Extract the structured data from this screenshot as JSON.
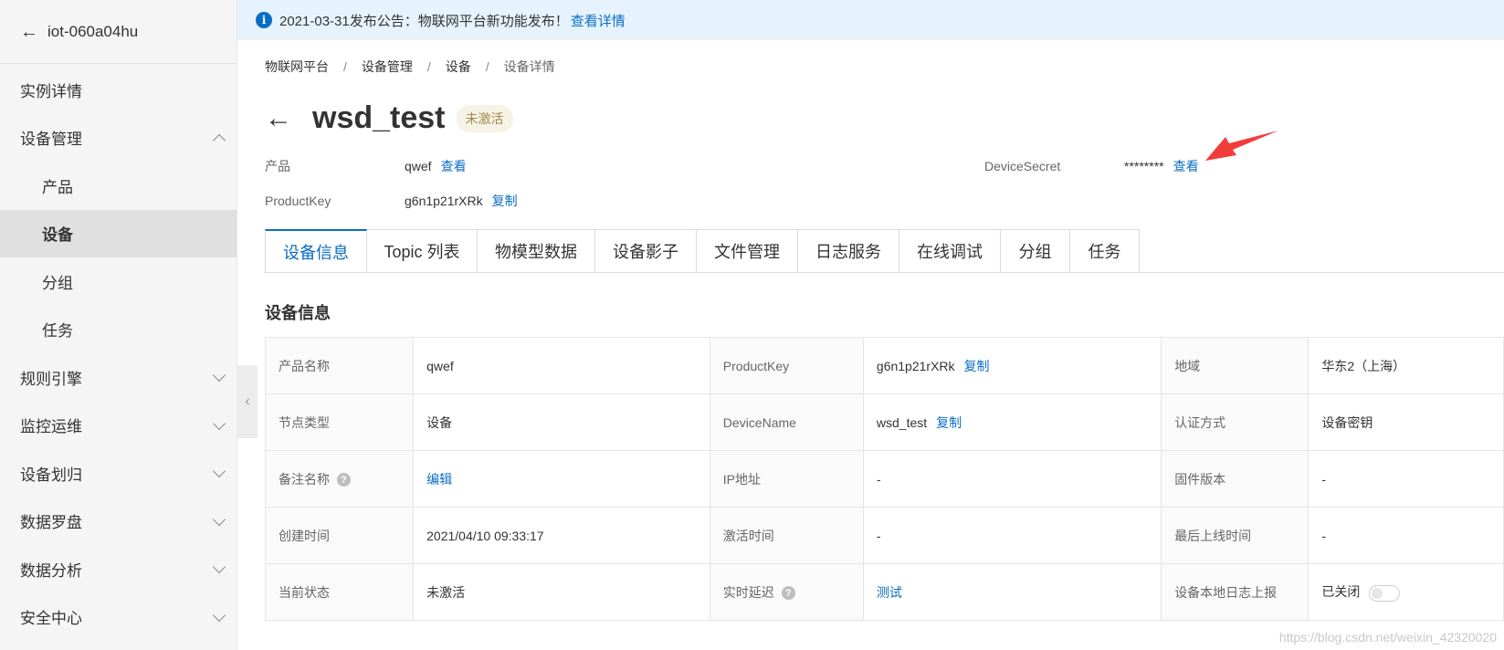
{
  "sidebar": {
    "title": "iot-060a04hu",
    "items": [
      {
        "label": "实例详情"
      },
      {
        "label": "设备管理"
      },
      {
        "label": "产品"
      },
      {
        "label": "设备"
      },
      {
        "label": "分组"
      },
      {
        "label": "任务"
      },
      {
        "label": "规则引擎"
      },
      {
        "label": "监控运维"
      },
      {
        "label": "设备划归"
      },
      {
        "label": "数据罗盘"
      },
      {
        "label": "数据分析"
      },
      {
        "label": "安全中心"
      }
    ]
  },
  "notice": {
    "text": "2021-03-31发布公告：物联网平台新功能发布！",
    "link": "查看详情"
  },
  "breadcrumb": [
    "物联网平台",
    "设备管理",
    "设备",
    "设备详情"
  ],
  "device": {
    "name": "wsd_test",
    "status_badge": "未激活"
  },
  "meta": {
    "product_label": "产品",
    "product_value": "qwef",
    "product_link": "查看",
    "productkey_label": "ProductKey",
    "productkey_value": "g6n1p21rXRk",
    "productkey_link": "复制",
    "secret_label": "DeviceSecret",
    "secret_value": "********",
    "secret_link": "查看"
  },
  "tabs": [
    "设备信息",
    "Topic 列表",
    "物模型数据",
    "设备影子",
    "文件管理",
    "日志服务",
    "在线调试",
    "分组",
    "任务"
  ],
  "section_title": "设备信息",
  "info": {
    "r1": {
      "k1": "产品名称",
      "v1": "qwef",
      "k2": "ProductKey",
      "v2": "g6n1p21rXRk",
      "v2_link": "复制",
      "k3": "地域",
      "v3": "华东2（上海）"
    },
    "r2": {
      "k1": "节点类型",
      "v1": "设备",
      "k2": "DeviceName",
      "v2": "wsd_test",
      "v2_link": "复制",
      "k3": "认证方式",
      "v3": "设备密钥"
    },
    "r3": {
      "k1": "备注名称",
      "v1": "编辑",
      "k2": "IP地址",
      "v2": "-",
      "k3": "固件版本",
      "v3": "-"
    },
    "r4": {
      "k1": "创建时间",
      "v1": "2021/04/10 09:33:17",
      "k2": "激活时间",
      "v2": "-",
      "k3": "最后上线时间",
      "v3": "-"
    },
    "r5": {
      "k1": "当前状态",
      "v1": "未激活",
      "k2": "实时延迟",
      "v2": "测试",
      "k3": "设备本地日志上报",
      "v3": "已关闭"
    }
  },
  "watermark": "https://blog.csdn.net/weixin_42320020",
  "colors": {
    "accent": "#0a6dc6",
    "notice_bg": "#e6f3fd",
    "arrow": "#f23c3c"
  }
}
